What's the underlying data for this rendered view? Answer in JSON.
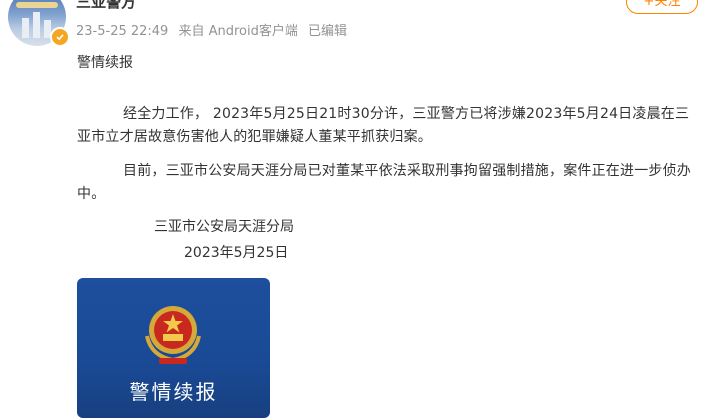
{
  "post": {
    "author_name": "三亚警方",
    "timestamp": "23-5-25 22:49",
    "source": "来自 Android客户端",
    "edit_status": "已编辑",
    "follow_label": "+关注",
    "title": "警情续报",
    "paragraphs": [
      "经全力工作， 2023年5月25日21时30分许，三亚警方已将涉嫌2023年5月24日凌晨在三亚市立才居故意伤害他人的犯罪嫌疑人董某平抓获归案。",
      "目前，三亚市公安局天涯分局已对董某平依法采取刑事拘留强制措施，案件正在进一步侦办中。"
    ],
    "signature_org": "三亚市公安局天涯分局",
    "signature_date": "2023年5月25日",
    "image_card_label": "警情续报"
  },
  "colors": {
    "accent": "#ff8200",
    "verified_badge": "#f5a623",
    "card_blue": "#1d4f9e",
    "meta_gray": "#939393"
  },
  "icons": {
    "verified": "verified-badge-icon",
    "emblem": "police-emblem-icon"
  }
}
